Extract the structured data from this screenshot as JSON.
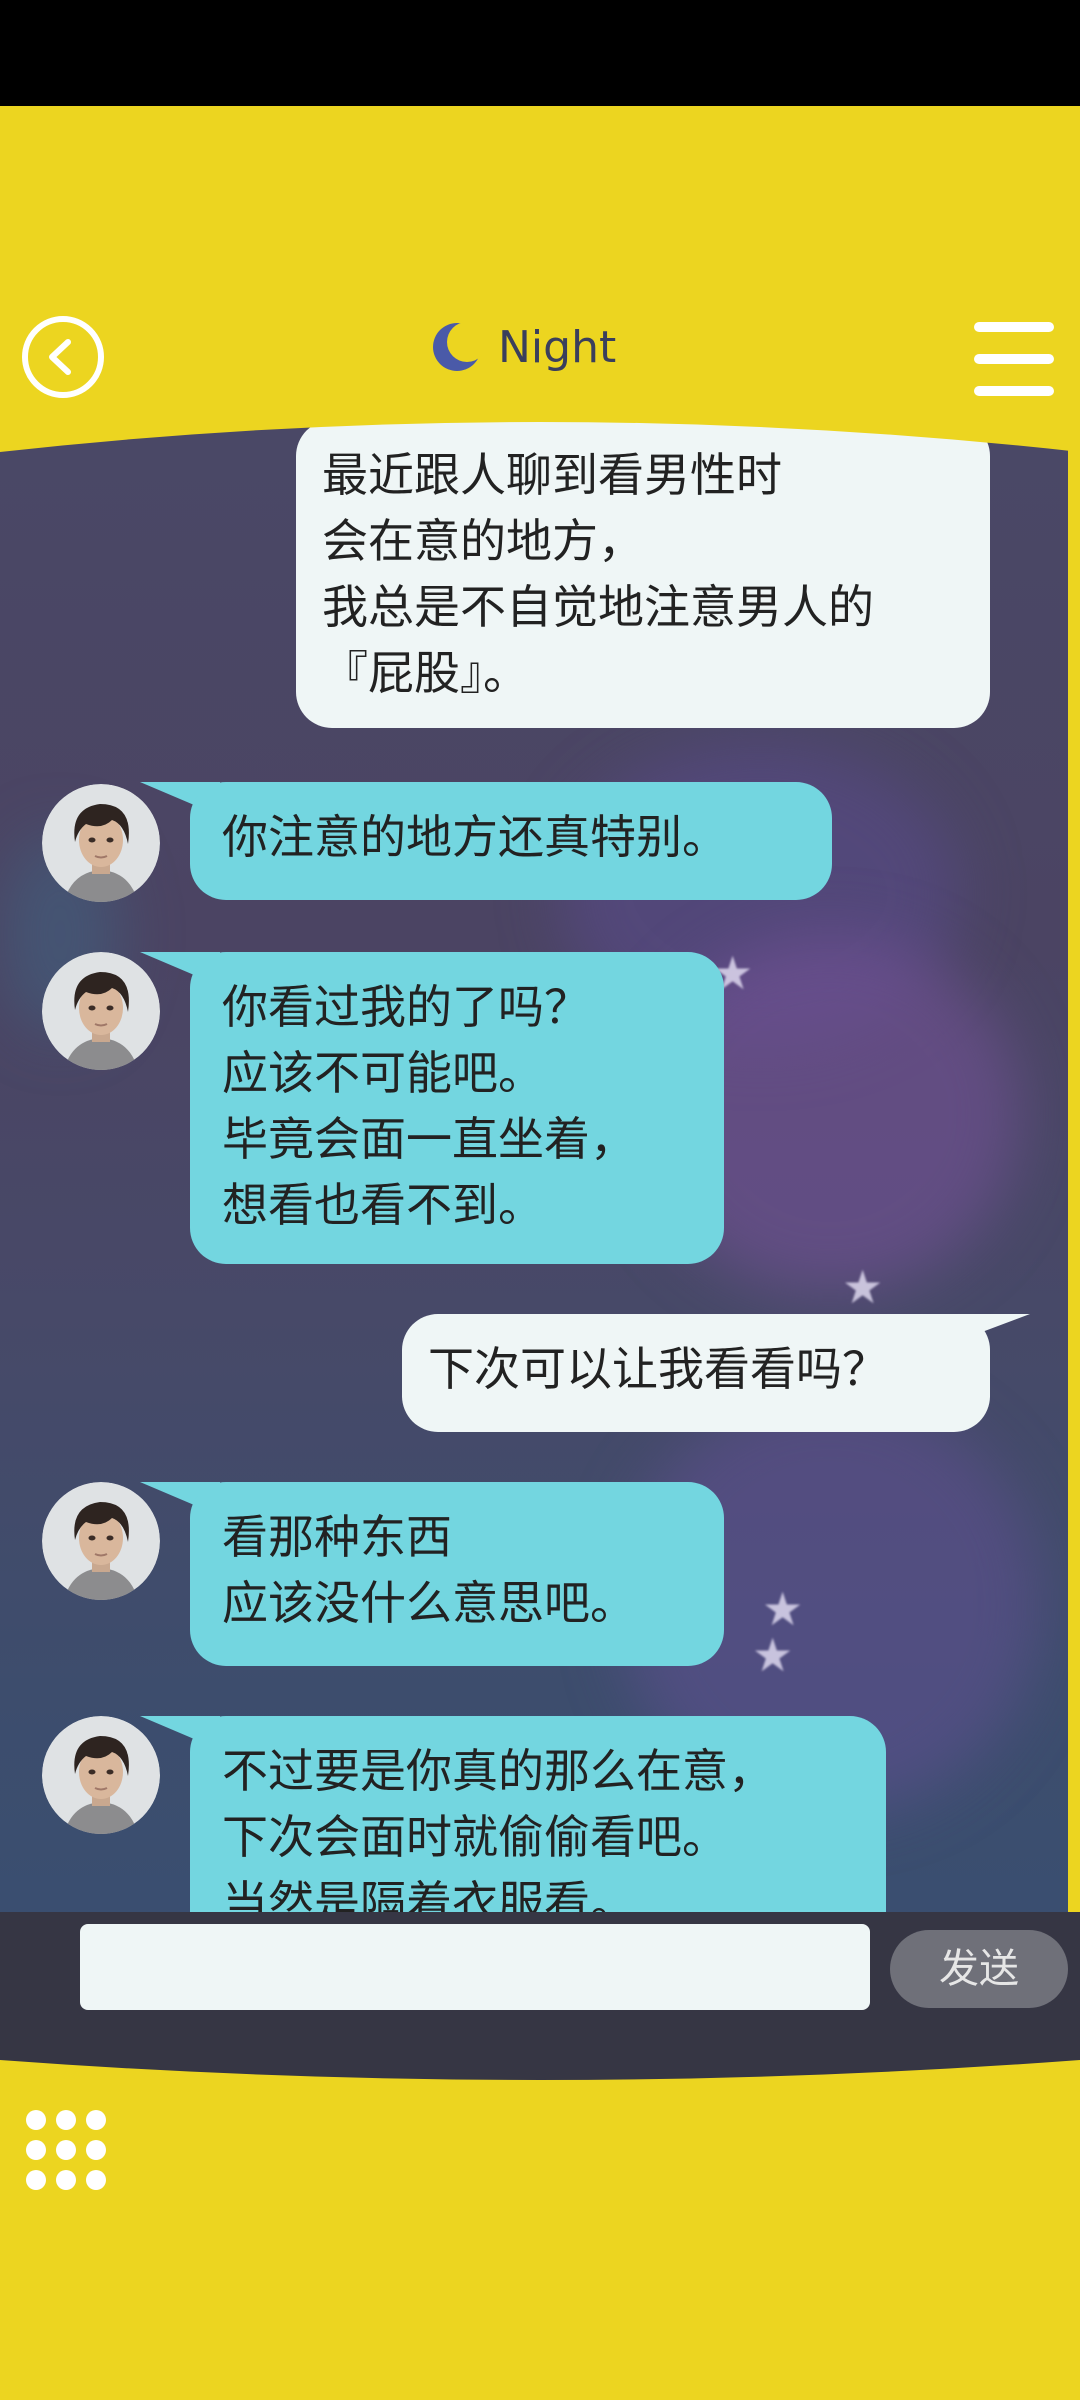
{
  "header": {
    "title": "Night",
    "back_icon": "chevron-left-icon",
    "title_icon": "moon-icon",
    "menu_icon": "hamburger-menu-icon"
  },
  "theme": {
    "frame_color": "#ecd520",
    "incoming_bubble": "#73d6e0",
    "outgoing_bubble": "#eff6f6",
    "send_button": "#6f7079"
  },
  "messages": [
    {
      "sender": "me",
      "lines": [
        "最近跟人聊到看男性时",
        "会在意的地方，",
        "我总是不自觉地注意男人的",
        "『屁股』。"
      ]
    },
    {
      "sender": "contact",
      "lines": [
        "你注意的地方还真特别。"
      ]
    },
    {
      "sender": "contact",
      "lines": [
        "你看过我的了吗？",
        "应该不可能吧。",
        "毕竟会面一直坐着，",
        "想看也看不到。"
      ]
    },
    {
      "sender": "me",
      "lines": [
        "下次可以让我看看吗？"
      ]
    },
    {
      "sender": "contact",
      "lines": [
        "看那种东西",
        "应该没什么意思吧。"
      ]
    },
    {
      "sender": "contact",
      "lines": [
        "不过要是你真的那么在意，",
        "下次会面时就偷偷看吧。",
        "当然是隔着衣服看。"
      ]
    }
  ],
  "composer": {
    "input_value": "",
    "input_placeholder": "",
    "send_label": "发送"
  },
  "bottom": {
    "grid_icon": "grid-dots-icon"
  }
}
